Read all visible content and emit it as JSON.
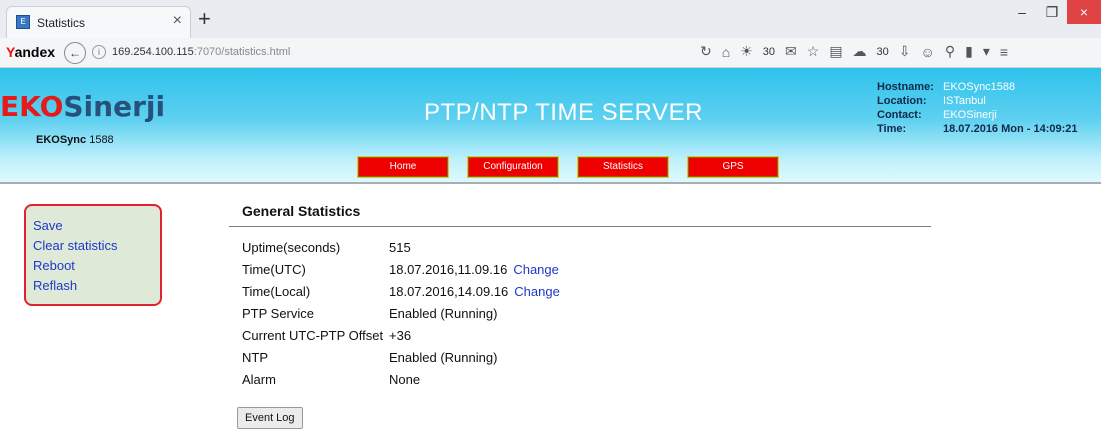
{
  "browser": {
    "tab_title": "Statistics",
    "favicon_text": "E",
    "new_tab": "+",
    "brand": "Yandex",
    "url_host": "169.254.100.115",
    "url_rest": ":7070/statistics.html",
    "weather1": "30",
    "weather2": "30"
  },
  "header": {
    "logo_eko": "EKO",
    "logo_sinerji": "Sinerji",
    "device_bold": "EKOSync",
    "device_num": "1588",
    "title": "PTP/NTP TIME SERVER",
    "info": [
      {
        "key": "Hostname:",
        "value": "EKOSync1588"
      },
      {
        "key": "Location:",
        "value": "ISTanbul"
      },
      {
        "key": "Contact:",
        "value": "EKOSinerji"
      },
      {
        "key": "Time:",
        "value": "18.07.2016 Mon - 14:09:21"
      }
    ]
  },
  "nav": [
    "Home",
    "Configuration",
    "Statistics",
    "GPS"
  ],
  "sidebar": [
    "Save",
    "Clear statistics",
    "Reboot",
    "Reflash"
  ],
  "stats": {
    "title": "General Statistics",
    "change_label": "Change",
    "rows": [
      {
        "label": "Uptime(seconds)",
        "value": "515"
      },
      {
        "label": "Time(UTC)",
        "value": "18.07.2016,11.09.16"
      },
      {
        "label": "Time(Local)",
        "value": "18.07.2016,14.09.16"
      },
      {
        "label": "PTP Service",
        "value": "Enabled (Running)"
      },
      {
        "label": "Current UTC-PTP Offset",
        "value": "+36"
      },
      {
        "label": "NTP",
        "value": "Enabled (Running)"
      },
      {
        "label": "Alarm",
        "value": "None"
      }
    ],
    "event_log": "Event Log"
  }
}
